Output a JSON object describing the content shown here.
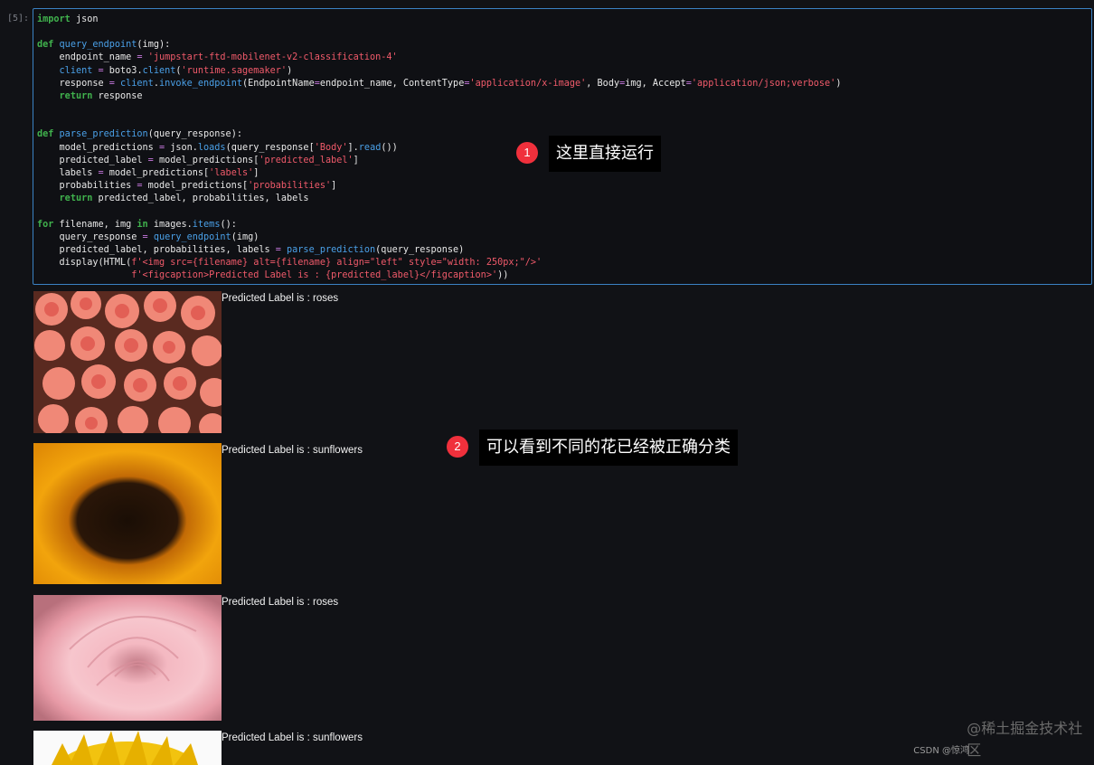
{
  "cell": {
    "prompt": "[5]:",
    "code_lines": [
      "import json",
      "",
      "def query_endpoint(img):",
      "    endpoint_name = 'jumpstart-ftd-mobilenet-v2-classification-4'",
      "    client = boto3.client('runtime.sagemaker')",
      "    response = client.invoke_endpoint(EndpointName=endpoint_name, ContentType='application/x-image', Body=img, Accept='application/json;verbose')",
      "    return response",
      "",
      "",
      "def parse_prediction(query_response):",
      "    model_predictions = json.loads(query_response['Body'].read())",
      "    predicted_label = model_predictions['predicted_label']",
      "    labels = model_predictions['labels']",
      "    probabilities = model_predictions['probabilities']",
      "    return predicted_label, probabilities, labels",
      "",
      "for filename, img in images.items():",
      "    query_response = query_endpoint(img)",
      "    predicted_label, probabilities, labels = parse_prediction(query_response)",
      "    display(HTML(f'<img src={filename} alt={filename} align=\"left\" style=\"width: 250px;\"/>'",
      "                 f'<figcaption>Predicted Label is : {predicted_label}</figcaption>'))"
    ]
  },
  "outputs": [
    {
      "caption": "Predicted Label is : roses",
      "image": "pink-roses-bouquet"
    },
    {
      "caption": "Predicted Label is : sunflowers",
      "image": "sunflower-closeup"
    },
    {
      "caption": "Predicted Label is : roses",
      "image": "pink-rose-closeup"
    },
    {
      "caption": "Predicted Label is : sunflowers",
      "image": "sunflower-partial"
    }
  ],
  "annotations": [
    {
      "number": "1",
      "text": "这里直接运行"
    },
    {
      "number": "2",
      "text": "可以看到不同的花已经被正确分类"
    }
  ],
  "watermark": {
    "main": "@稀土掘金技术社区",
    "small": "CSDN @惊鸿"
  }
}
